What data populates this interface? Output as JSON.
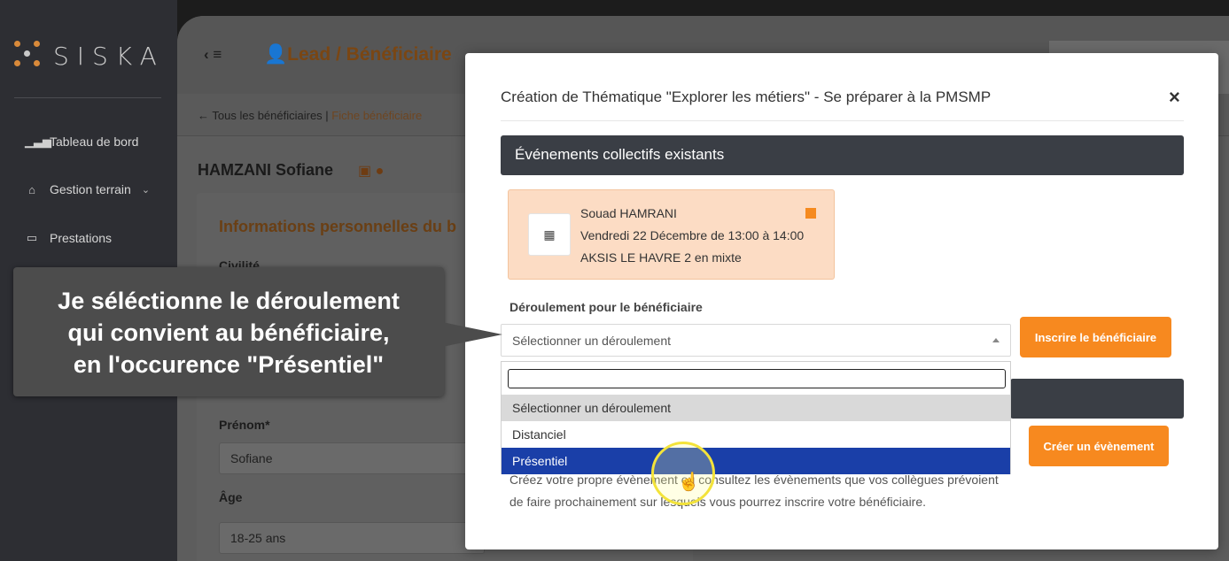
{
  "sidebar": {
    "logo_text": "SISKA",
    "items": [
      {
        "label": "Tableau de bord",
        "icon": "chart-icon"
      },
      {
        "label": "Gestion terrain",
        "icon": "house-icon"
      },
      {
        "label": "Prestations",
        "icon": "window-icon"
      }
    ]
  },
  "header": {
    "title": "Lead / Bénéficiaire",
    "breadcrumb_back": "Tous les bénéficiaires |",
    "breadcrumb_current": "Fiche bénéficiaire"
  },
  "beneficiary": {
    "name": "HAMZANI Sofiane",
    "section_title": "Informations personnelles du b",
    "civility_label": "Civilité",
    "firstname_label": "Prénom*",
    "firstname_value": "Sofiane",
    "age_label": "Âge",
    "age_value": "18-25 ans"
  },
  "modal": {
    "title": "Création de Thématique \"Explorer les métiers\" - Se préparer à la PMSMP",
    "close": "×",
    "existing_events_heading": "Événements collectifs existants",
    "event": {
      "organizer": "Souad HAMRANI",
      "datetime": "Vendredi 22 Décembre de 13:00 à 14:00",
      "location": "AKSIS LE HAVRE 2 en mixte",
      "status_color": "#f58a1f"
    },
    "deroulement_label": "Déroulement pour le bénéficiaire",
    "select_value": "Sélectionner un déroulement",
    "inscribe_button": "Inscrire le bénéficiaire",
    "create_event_button": "Créer un évènement",
    "options": [
      "Sélectionner un déroulement",
      "Distanciel",
      "Présentiel"
    ],
    "selected_option": "Présentiel",
    "help_line1": "Créez votre propre évènement ou consultez les évènements que vos collègues prévoient",
    "help_line2": "de faire prochainement sur lesquels vous pourrez inscrire votre bénéficiaire."
  },
  "callout": {
    "line1": "Je séléctionne le déroulement",
    "line2": "qui convient au bénéficiaire,",
    "line3": "en l'occurence \"Présentiel\""
  },
  "colors": {
    "accent": "#f7891f",
    "dark_band": "#3a3e45",
    "highlight": "#1a3fa8"
  }
}
